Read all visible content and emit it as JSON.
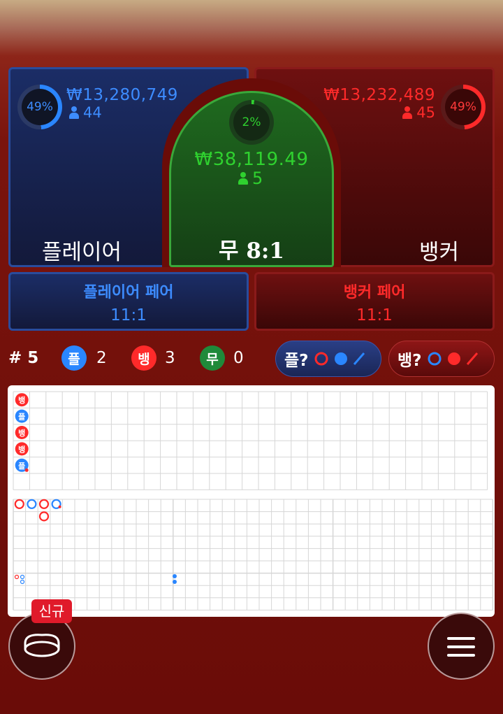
{
  "player": {
    "label": "플레이어",
    "percent": "49%",
    "amount": "₩13,280,749",
    "count": "44",
    "ring_fill": 0.49,
    "color": "#2a86ff"
  },
  "tie": {
    "label": "무 8:1",
    "percent": "2%",
    "amount": "₩38,119.49",
    "count": "5",
    "ring_fill": 0.02,
    "color": "#2fd12f"
  },
  "banker": {
    "label": "뱅커",
    "percent": "49%",
    "amount": "₩13,232,489",
    "count": "45",
    "ring_fill": 0.49,
    "color": "#ff2a2a"
  },
  "player_pair": {
    "label": "플레이어 페어",
    "odds": "11:1"
  },
  "banker_pair": {
    "label": "뱅커 페어",
    "odds": "11:1"
  },
  "stats": {
    "round": "# 5",
    "player_chip": "플",
    "player_count": "2",
    "banker_chip": "뱅",
    "banker_count": "3",
    "tie_chip": "무",
    "tie_count": "0"
  },
  "predict": {
    "player_label": "플?",
    "banker_label": "뱅?"
  },
  "bead_road": [
    {
      "label": "뱅",
      "type": "banker",
      "player_pair": false
    },
    {
      "label": "플",
      "type": "player",
      "player_pair": false
    },
    {
      "label": "뱅",
      "type": "banker",
      "player_pair": false
    },
    {
      "label": "뱅",
      "type": "banker",
      "player_pair": false
    },
    {
      "label": "플",
      "type": "player",
      "banker_pair": true
    }
  ],
  "new_badge": "신규",
  "icons": {
    "chip": "chip-stack-icon",
    "menu": "hamburger-menu-icon",
    "person": "person-icon"
  },
  "colors": {
    "player": "#2a86ff",
    "banker": "#ff2a2a",
    "tie": "#2fd12f",
    "grid": "#d6d6d6"
  }
}
